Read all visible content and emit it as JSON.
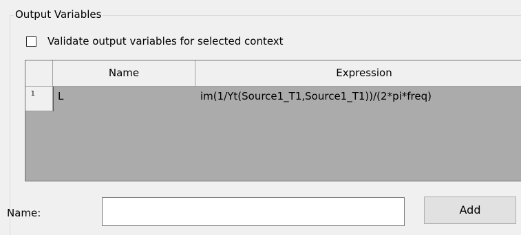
{
  "group": {
    "title": "Output Variables"
  },
  "validate_checkbox": {
    "label": "Validate output variables for selected context",
    "checked": false
  },
  "grid": {
    "columns": [
      "",
      "Name",
      "Expression"
    ],
    "rows": [
      {
        "index": "1",
        "name": "L",
        "expression": "im(1/Yt(Source1_T1,Source1_T1))/(2*pi*freq)"
      }
    ]
  },
  "form": {
    "name_label": "Name:",
    "name_value": "",
    "add_label": "Add"
  }
}
